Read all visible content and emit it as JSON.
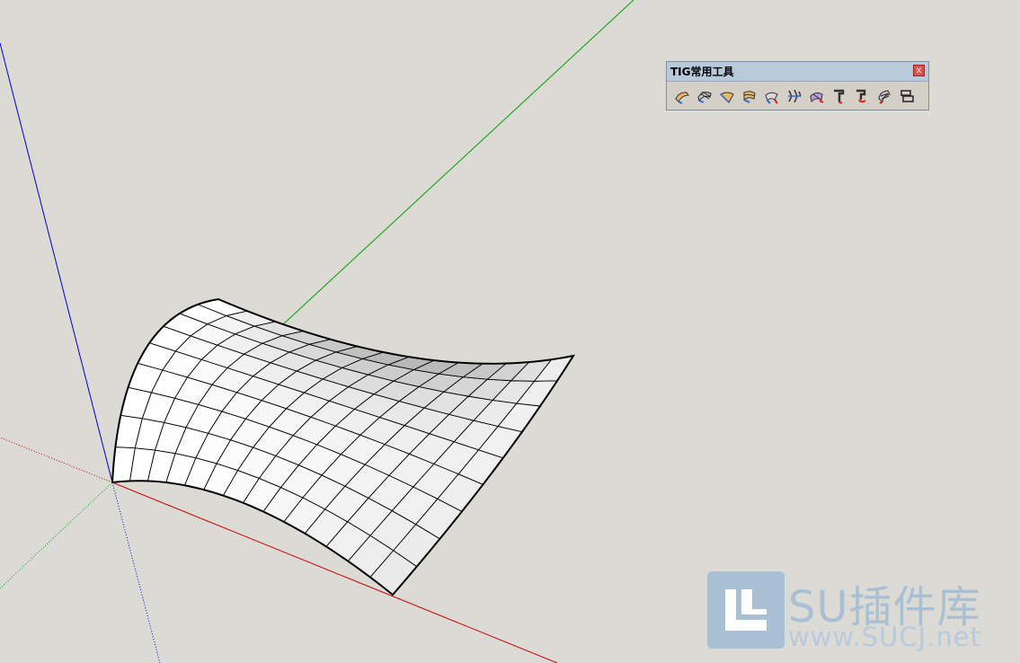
{
  "toolbar": {
    "title": "TIG常用工具",
    "close_label": "x",
    "tools": [
      {
        "icon": "surface-tool-1-icon"
      },
      {
        "icon": "surface-tool-2-icon"
      },
      {
        "icon": "surface-tool-3-icon"
      },
      {
        "icon": "surface-tool-4-icon"
      },
      {
        "icon": "surface-tool-5-icon"
      },
      {
        "icon": "surface-tool-6-icon"
      },
      {
        "icon": "surface-tool-7-icon"
      },
      {
        "icon": "pipe-tool-1-icon"
      },
      {
        "icon": "pipe-tool-2-icon"
      },
      {
        "icon": "surface-tool-8-icon"
      },
      {
        "icon": "frame-tool-icon"
      }
    ]
  },
  "watermark": {
    "name": "SU插件库",
    "url": "www.SUCJ.net"
  },
  "colors": {
    "background": "#dcdad5",
    "axis_red": "#cc0000",
    "axis_green": "#00a000",
    "axis_blue": "#0000cc",
    "watermark": "#a9c0d4"
  }
}
